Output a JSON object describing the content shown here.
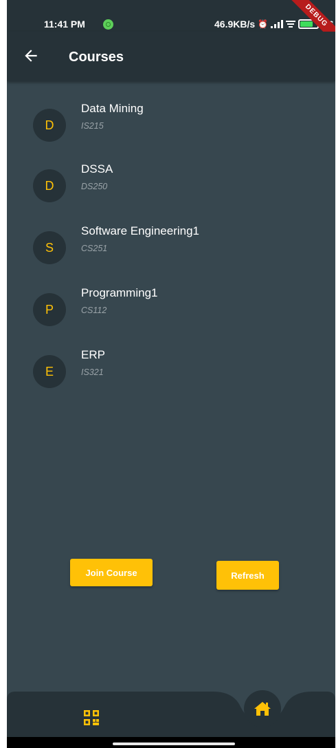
{
  "status_bar": {
    "time": "11:41 PM",
    "speed": "46.9KB/s",
    "battery_text": "76",
    "debug_label": "DEBUG"
  },
  "app_bar": {
    "title": "Courses",
    "back_icon": "arrow-left-icon"
  },
  "courses": [
    {
      "initial": "D",
      "name": "Data Mining",
      "code": "IS215"
    },
    {
      "initial": "D",
      "name": "DSSA",
      "code": "DS250"
    },
    {
      "initial": "S",
      "name": "Software Engineering1",
      "code": "CS251"
    },
    {
      "initial": "P",
      "name": "Programming1",
      "code": "CS112"
    },
    {
      "initial": "E",
      "name": "ERP",
      "code": "IS321"
    }
  ],
  "buttons": {
    "join": "Join Course",
    "refresh": "Refresh"
  },
  "bottom_nav": {
    "left_icon": "qr-code-icon",
    "center_icon": "home-icon"
  },
  "colors": {
    "background": "#37474f",
    "bar": "#263238",
    "accent": "#ffc107",
    "text": "#ffffff",
    "subtext": "#9aa3a8"
  }
}
